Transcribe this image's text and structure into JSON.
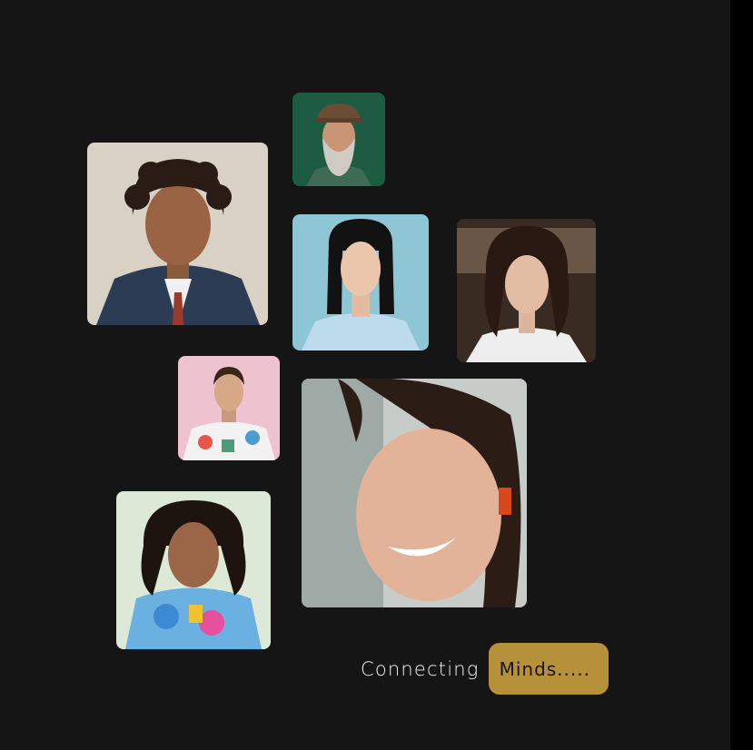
{
  "tagline": {
    "word": "Connecting",
    "highlight": "Minds....."
  },
  "colors": {
    "background": "#151515",
    "accent": "#b7913a",
    "text": "#f2f2f2"
  },
  "portraits": [
    {
      "name": "portrait-curly-man-suit"
    },
    {
      "name": "portrait-bearded-man-cap"
    },
    {
      "name": "portrait-woman-blue-shirt"
    },
    {
      "name": "portrait-woman-cafe"
    },
    {
      "name": "portrait-man-colorful-hoodie"
    },
    {
      "name": "portrait-woman-smiling-earring"
    },
    {
      "name": "portrait-woman-graffiti-hoodie"
    }
  ]
}
